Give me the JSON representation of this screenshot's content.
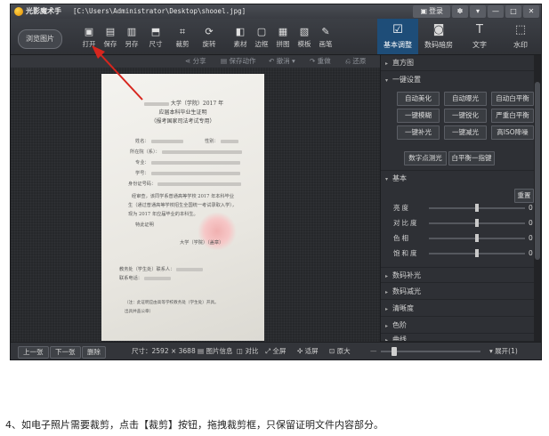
{
  "title_bar": {
    "app_name": "光影魔术手",
    "file_path": "[C:\\Users\\Administrator\\Desktop\\shooel.jpg]",
    "login_label": "登录",
    "buttons": [
      "✽",
      "▾",
      "—",
      "□",
      "✕"
    ]
  },
  "toolbar": {
    "browse_label": "浏览图片",
    "tools": [
      {
        "label": "打开",
        "icon": "open-icon",
        "glyph": "▣"
      },
      {
        "label": "保存",
        "icon": "save-icon",
        "glyph": "▤"
      },
      {
        "label": "另存",
        "icon": "save-as-icon",
        "glyph": "▥"
      },
      {
        "label": "尺寸",
        "icon": "resize-icon",
        "glyph": "⬒"
      },
      {
        "label": "裁剪",
        "icon": "crop-icon",
        "glyph": "⌗"
      },
      {
        "label": "旋转",
        "icon": "rotate-icon",
        "glyph": "⟳"
      },
      {
        "label": "素材",
        "icon": "material-icon",
        "glyph": "◧"
      },
      {
        "label": "边框",
        "icon": "frame-icon",
        "glyph": "▢"
      },
      {
        "label": "拼图",
        "icon": "puzzle-icon",
        "glyph": "▦"
      },
      {
        "label": "模板",
        "icon": "template-icon",
        "glyph": "▧"
      },
      {
        "label": "画笔",
        "icon": "brush-icon",
        "glyph": "✎"
      }
    ],
    "right_tabs": [
      {
        "label": "基本调整",
        "icon": "adjust-icon",
        "glyph": "☑",
        "active": true
      },
      {
        "label": "数码暗房",
        "icon": "darkroom-icon",
        "glyph": "◙",
        "active": false
      },
      {
        "label": "文字",
        "icon": "text-icon",
        "glyph": "T",
        "active": false
      },
      {
        "label": "水印",
        "icon": "watermark-icon",
        "glyph": "⬚",
        "active": false
      }
    ]
  },
  "subbar": {
    "share": "分享",
    "save_action": "保存动作",
    "undo": "撤消",
    "redo": "重做",
    "restore": "还原"
  },
  "document": {
    "line1": "大学（学院）2017 年",
    "line2": "应届本科毕业生证明",
    "line3": "（报考国家司法考试专用）",
    "f_name": "姓名：",
    "f_gender": "性别：",
    "f_school": "所在院（系）：",
    "f_major": "专业：",
    "f_student_no": "学号：",
    "f_id": "身份证号码：",
    "p1": "经审查，该同学系普通高等学校 2017 年本科毕业",
    "p2": "生（通过普通高等学校招生全国统一考试录取入学），",
    "p3": "现为 2017 年应届毕业的本科生。",
    "p4": "特此证明",
    "p5": "大学（学院）（盖章）",
    "p6": "教务处（学生处）联系人：",
    "p7": "联系电话：",
    "p8": "（注：此证明应由高等学校教务处（学生处）开具。",
    "p9": "出具并盖公章）"
  },
  "panel": {
    "histogram": "直方图",
    "one_click": "一键设置",
    "buttons": [
      "自动美化",
      "自动曝光",
      "自动白平衡",
      "一键模糊",
      "一键锐化",
      "严重白平衡",
      "一键补光",
      "一键减光",
      "高ISO降噪"
    ],
    "digital_fill": "数字点测光",
    "wb_one": "白平衡一指键",
    "basic": "基本",
    "reset": "重置",
    "sliders": [
      {
        "label": "亮度",
        "value": "0"
      },
      {
        "label": "对比度",
        "value": "0"
      },
      {
        "label": "色相",
        "value": "0"
      },
      {
        "label": "饱和度",
        "value": "0"
      }
    ],
    "sections": [
      "数码补光",
      "数码减光",
      "清晰度",
      "色阶",
      "曲线"
    ]
  },
  "bottom": {
    "prev": "上一张",
    "next": "下一张",
    "delete": "删除",
    "size": "尺寸：2592 × 3688",
    "info": "图片信息",
    "compare": "对比",
    "fullscreen": "全屏",
    "fit": "适屏",
    "original": "原大",
    "expand": "展开(1)"
  },
  "caption": "4、如电子照片需要裁剪，点击【裁剪】按钮，拖拽裁剪框，只保留证明文件内容部分。"
}
